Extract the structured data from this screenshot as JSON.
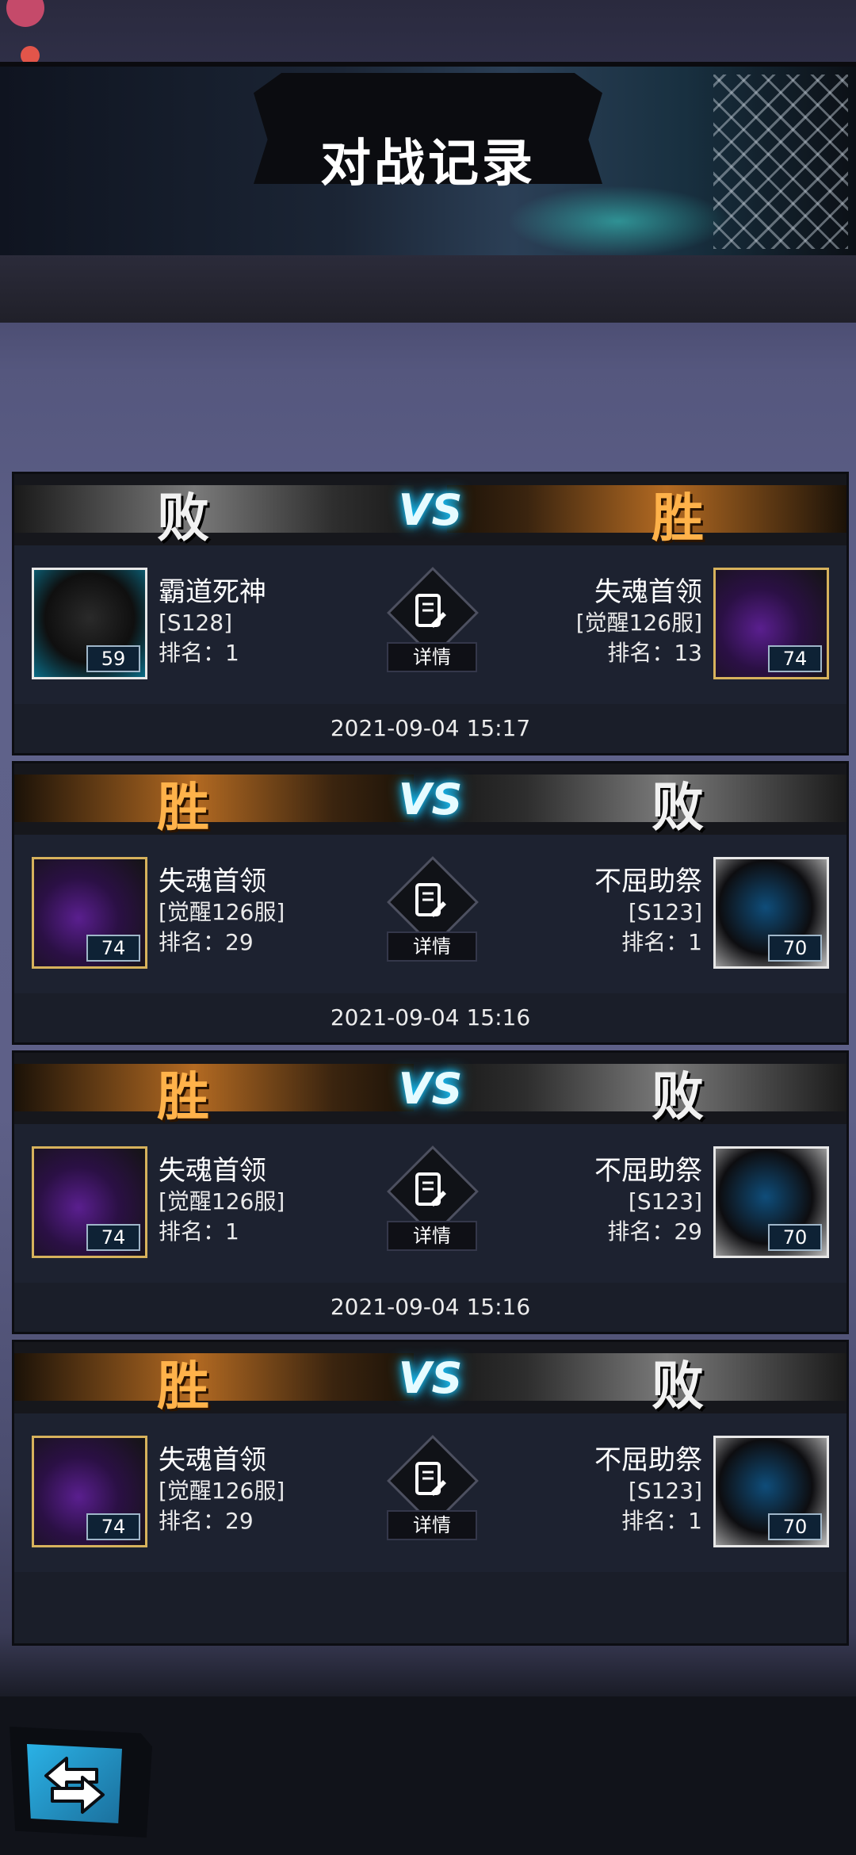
{
  "header": {
    "title": "对战记录"
  },
  "battles": [
    {
      "left": {
        "result": "败",
        "name": "霸道死神",
        "server": "[S128]",
        "rank": "排名：1",
        "level": "59",
        "portrait": "black-dragon"
      },
      "vs": "VS",
      "detail_label": "详情",
      "right": {
        "result": "胜",
        "name": "失魂首领",
        "server": "[觉醒126服]",
        "rank": "排名：13",
        "level": "74",
        "portrait": "purple-masked"
      },
      "timestamp": "2021-09-04 15:17"
    },
    {
      "left": {
        "result": "胜",
        "name": "失魂首领",
        "server": "[觉醒126服]",
        "rank": "排名：29",
        "level": "74",
        "portrait": "purple-masked"
      },
      "vs": "VS",
      "detail_label": "详情",
      "right": {
        "result": "败",
        "name": "不屈助祭",
        "server": "[S123]",
        "rank": "排名：1",
        "level": "70",
        "portrait": "dark-knight"
      },
      "timestamp": "2021-09-04 15:16"
    },
    {
      "left": {
        "result": "胜",
        "name": "失魂首领",
        "server": "[觉醒126服]",
        "rank": "排名：1",
        "level": "74",
        "portrait": "purple-masked"
      },
      "vs": "VS",
      "detail_label": "详情",
      "right": {
        "result": "败",
        "name": "不屈助祭",
        "server": "[S123]",
        "rank": "排名：29",
        "level": "70",
        "portrait": "dark-knight"
      },
      "timestamp": "2021-09-04 15:16"
    },
    {
      "left": {
        "result": "胜",
        "name": "失魂首领",
        "server": "[觉醒126服]",
        "rank": "排名：29",
        "level": "74",
        "portrait": "purple-masked"
      },
      "vs": "VS",
      "detail_label": "详情",
      "right": {
        "result": "败",
        "name": "不屈助祭",
        "server": "[S123]",
        "rank": "排名：1",
        "level": "70",
        "portrait": "dark-knight"
      },
      "timestamp": ""
    }
  ],
  "colors": {
    "win": "#ffb24a",
    "lose": "#f1f1f1",
    "vs_glow": "#18c6ff"
  },
  "icons": {
    "detail": "document-edit-icon",
    "back": "back-arrow-icon"
  }
}
